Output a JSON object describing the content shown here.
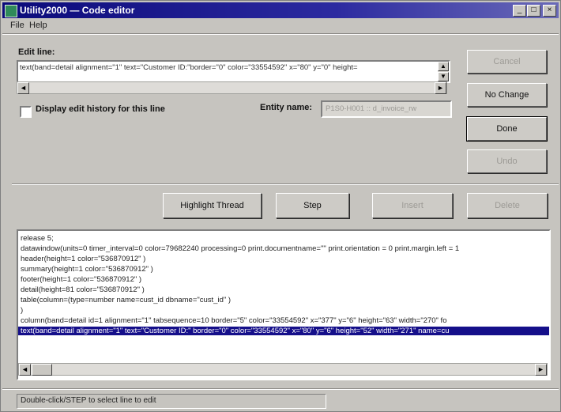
{
  "window": {
    "title": "Utility2000 — Code editor",
    "controls": {
      "minimize": "_",
      "maximize": "□",
      "close": "×"
    }
  },
  "menu": {
    "file": "File",
    "help": "Help"
  },
  "edit_line": {
    "label": "Edit line:",
    "value": "text(band=detail alignment=\"1\" text=\"Customer ID:\"border=\"0\" color=\"33554592\" x=\"80\" y=\"0\" height="
  },
  "history": {
    "label": "Display edit history for this line"
  },
  "entity": {
    "label": "Entity name:",
    "value": "P1S0-H001 :: d_invoice_rw"
  },
  "buttons": {
    "cancel": "Cancel",
    "no_change": "No Change",
    "done": "Done",
    "undo": "Undo",
    "highlight": "Highlight Thread",
    "step": "Step",
    "insert": "Insert",
    "delete": "Delete"
  },
  "code_lines": [
    "release 5;",
    "datawindow(units=0 timer_interval=0 color=79682240 processing=0 print.documentname=\"\" print.orientation = 0 print.margin.left = 1",
    "header(height=1 color=\"536870912\" )",
    "summary(height=1 color=\"536870912\" )",
    "footer(height=1 color=\"536870912\" )",
    "detail(height=81 color=\"536870912\" )",
    "table(column=(type=number name=cust_id dbname=\"cust_id\" )",
    " )",
    "column(band=detail id=1 alignment=\"1\" tabsequence=10 border=\"5\" color=\"33554592\" x=\"377\" y=\"6\" height=\"63\" width=\"270\" fo",
    "text(band=detail alignment=\"1\" text=\"Customer ID:\" border=\"0\" color=\"33554592\" x=\"80\" y=\"6\" height=\"52\" width=\"271\" name=cu"
  ],
  "status": {
    "text": "Double-click/STEP to select line to edit"
  }
}
